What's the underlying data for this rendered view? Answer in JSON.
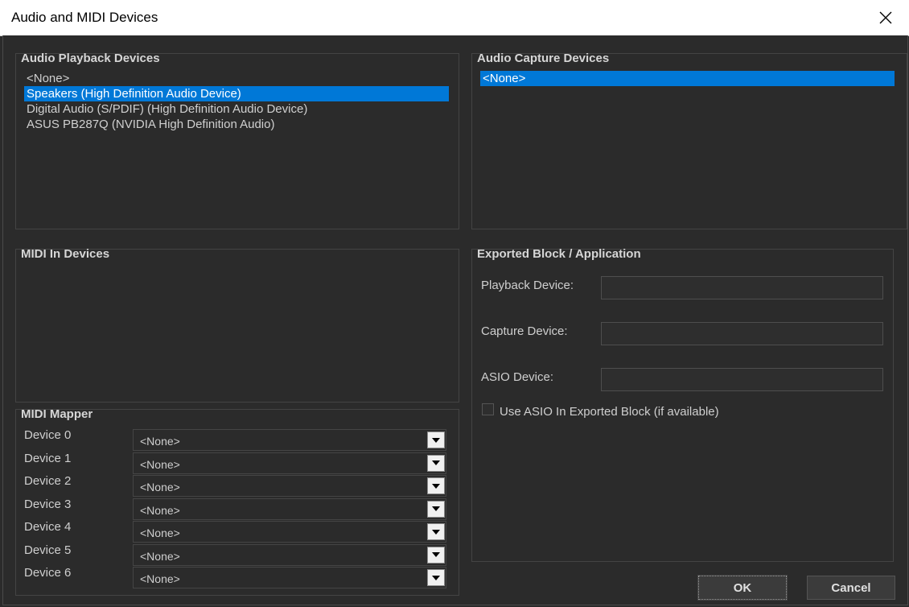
{
  "window": {
    "title": "Audio and MIDI Devices"
  },
  "playback": {
    "title": "Audio Playback Devices",
    "items": [
      "<None>",
      "Speakers (High Definition Audio Device)",
      "Digital Audio (S/PDIF) (High Definition Audio Device)",
      "ASUS PB287Q (NVIDIA High Definition Audio)"
    ],
    "selected_index": 1
  },
  "capture": {
    "title": "Audio Capture Devices",
    "items": [
      "<None>"
    ],
    "selected_index": 0
  },
  "midi_in": {
    "title": "MIDI In Devices",
    "items": []
  },
  "exported": {
    "title": "Exported Block / Application",
    "playback_label": "Playback Device:",
    "playback_value": "",
    "capture_label": "Capture Device:",
    "capture_value": "",
    "asio_label": "ASIO Device:",
    "asio_value": "",
    "use_asio_label": "Use ASIO In Exported Block (if available)",
    "use_asio_checked": false
  },
  "midi_mapper": {
    "title": "MIDI Mapper",
    "devices": [
      {
        "label": "Device 0",
        "value": "<None>"
      },
      {
        "label": "Device 1",
        "value": "<None>"
      },
      {
        "label": "Device 2",
        "value": "<None>"
      },
      {
        "label": "Device 3",
        "value": "<None>"
      },
      {
        "label": "Device 4",
        "value": "<None>"
      },
      {
        "label": "Device 5",
        "value": "<None>"
      },
      {
        "label": "Device 6",
        "value": "<None>"
      }
    ]
  },
  "buttons": {
    "ok": "OK",
    "cancel": "Cancel"
  },
  "colors": {
    "background": "#2b2b2b",
    "selection": "#0078d7",
    "text": "#d0d0d0"
  }
}
